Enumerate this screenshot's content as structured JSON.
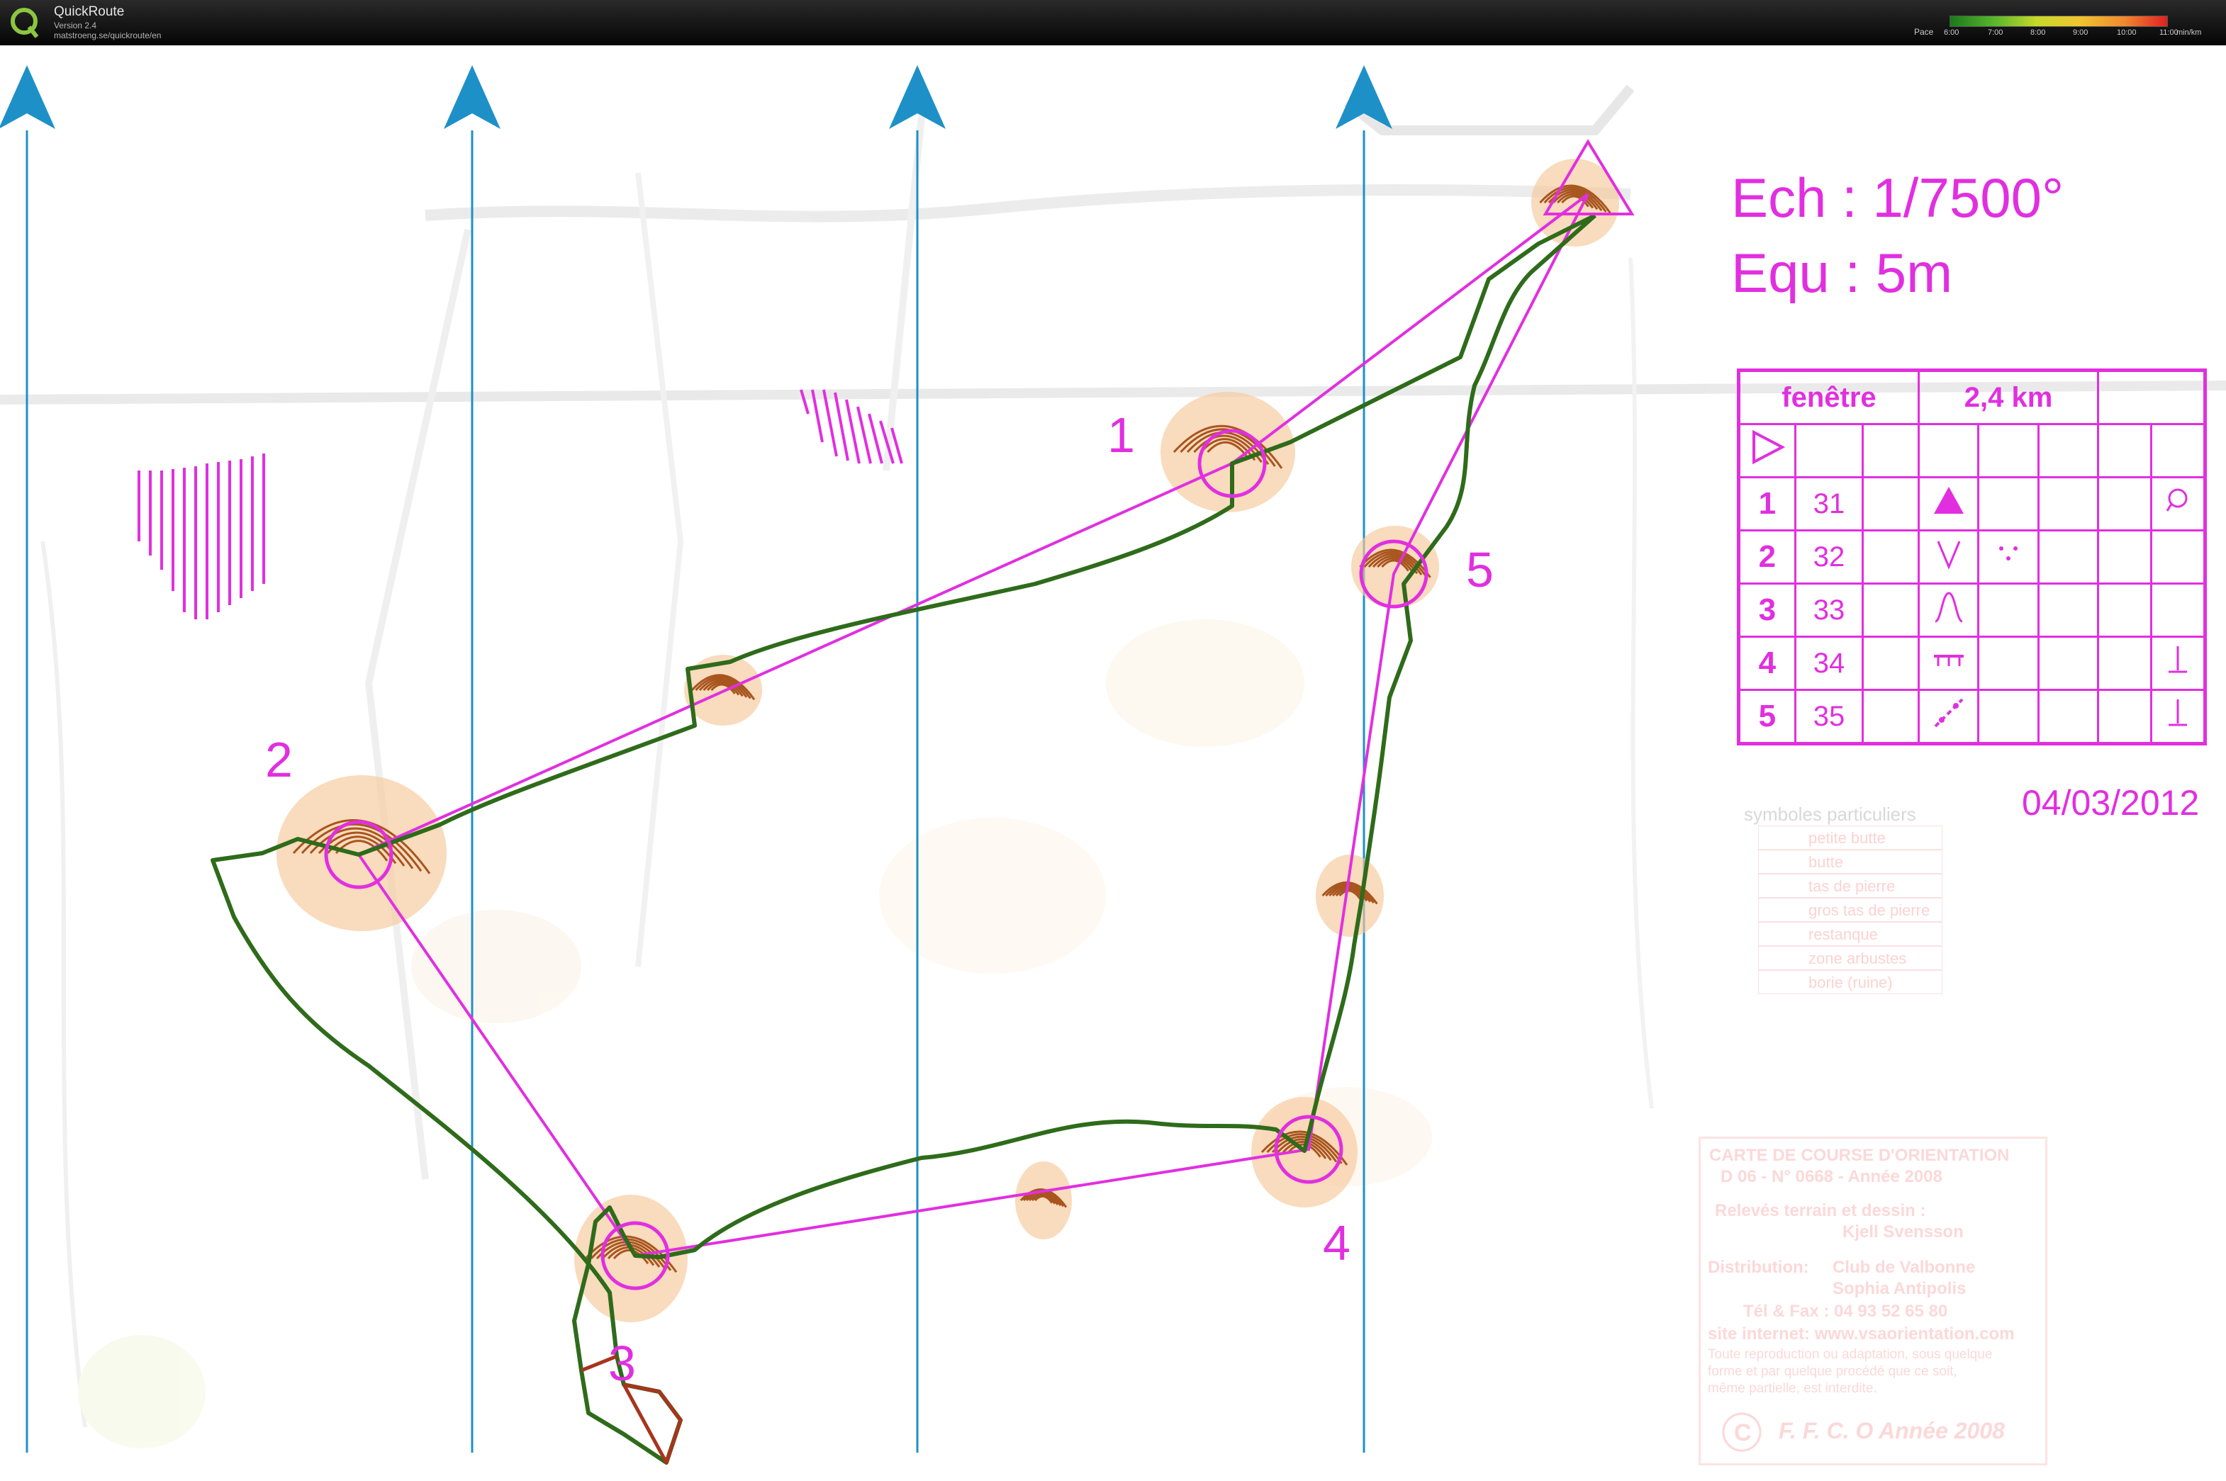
{
  "app": {
    "name": "QuickRoute",
    "version": "Version 2.4",
    "url": "matstroeng.se/quickroute/en"
  },
  "pace_legend": {
    "label": "Pace",
    "ticks": [
      "6:00",
      "7:00",
      "8:00",
      "9:00",
      "10:00",
      "11:00"
    ],
    "unit": "min/km"
  },
  "course": {
    "scale": "Ech : 1/7500°",
    "equidistance": "Equ : 5m",
    "name": "fenêtre",
    "length": "2,4 km",
    "date": "04/03/2012",
    "controls": [
      {
        "num": "1",
        "code": "31",
        "label": "1"
      },
      {
        "num": "2",
        "code": "32",
        "label": "2"
      },
      {
        "num": "3",
        "code": "33",
        "label": "3"
      },
      {
        "num": "4",
        "code": "34",
        "label": "4"
      },
      {
        "num": "5",
        "code": "35",
        "label": "5"
      }
    ]
  },
  "legend_special": {
    "title": "symboles particuliers",
    "items": [
      "petite butte",
      "butte",
      "tas de pierre",
      "gros tas de pierre",
      "restanque",
      "zone arbustes",
      "borie (ruine)"
    ]
  },
  "credits": {
    "line1": "CARTE DE COURSE D'ORIENTATION",
    "line2": "D 06 - N° 0668 - Année 2008",
    "line3": "Relevés terrain et dessin :",
    "line4": "Kjell Svensson",
    "line5": "Distribution:",
    "line6": "Club de Valbonne",
    "line7": "Sophia Antipolis",
    "line8": "Tél & Fax : 04 93 52 65 80",
    "line9": "site internet: www.vsaorientation.com",
    "line10": "Toute reproduction ou adaptation, sous quelque",
    "line11": "forme et par quelque procédé que ce soit,",
    "line12": "même partielle, est interdite.",
    "line13": "F. F. C. O Année 2008"
  },
  "colors": {
    "course": "#e12fe0",
    "north_lines": "#1e90c8",
    "route": "#2e6b1a",
    "route_slow": "#b03020",
    "terrain": "#f6c79a"
  }
}
